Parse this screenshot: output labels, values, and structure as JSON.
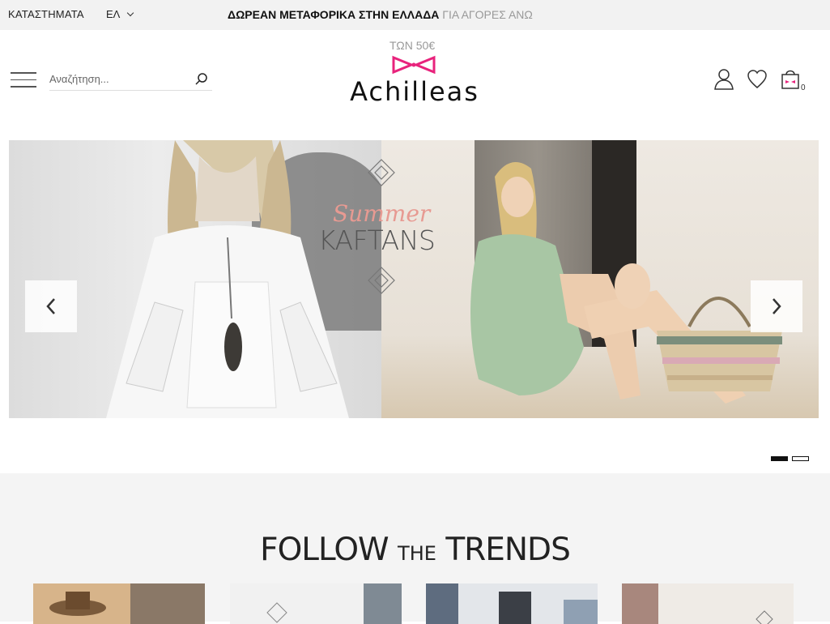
{
  "topbar": {
    "stores": "ΚΑΤΑΣΤΗΜΑΤΑ",
    "lang": "ΕΛ",
    "promo_bold": "ΔΩΡΕΑΝ ΜΕΤΑΦΟΡΙΚΑ ΣΤΗΝ ΕΛΛΑΔΑ",
    "promo_light": "ΓΙΑ ΑΓΟΡΕΣ ΑΝΩ",
    "promo_second": "ΤΩΝ 50€"
  },
  "header": {
    "search_placeholder": "Αναζήτηση...",
    "logo": "Achilleas",
    "cart_count": "0"
  },
  "hero": {
    "script_text": "Summer",
    "title_text": "KAFTANS",
    "slides": 2,
    "active_slide": 1
  },
  "trends": {
    "title_a": "FOLLOW",
    "title_small": "THE",
    "title_b": "TRENDS"
  },
  "colors": {
    "accent_pink": "#e8237c",
    "topbar_bg": "#f2f2f2"
  }
}
